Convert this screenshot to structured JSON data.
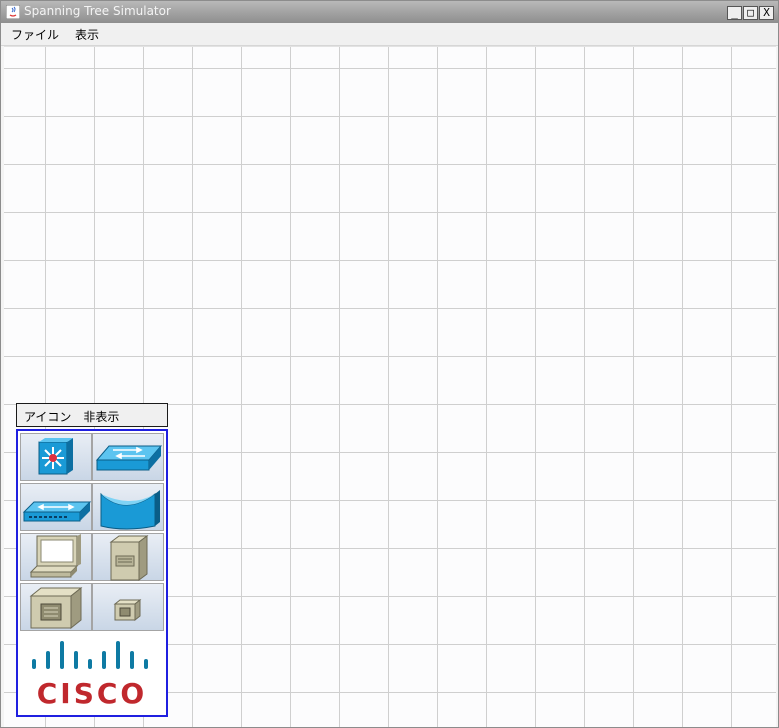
{
  "window": {
    "title": "Spanning Tree Simulator",
    "min_label": "_",
    "max_label": "□",
    "close_label": "X"
  },
  "menu": {
    "items": [
      {
        "label": "ファイル"
      },
      {
        "label": "表示"
      }
    ]
  },
  "palette": {
    "header_label": "アイコン　非表示",
    "icons": [
      {
        "name": "layer3-switch-icon"
      },
      {
        "name": "workgroup-switch-icon"
      },
      {
        "name": "hub-icon"
      },
      {
        "name": "bridge-icon"
      },
      {
        "name": "pc-icon"
      },
      {
        "name": "tower-server-icon"
      },
      {
        "name": "file-server-icon"
      },
      {
        "name": "small-host-icon"
      }
    ],
    "brand": "CISCO"
  },
  "colors": {
    "accent_border": "#1f1fe0",
    "cisco_bars": "#0e7aa3",
    "cisco_text": "#c0282d",
    "device_blue": "#1a9ad6"
  }
}
